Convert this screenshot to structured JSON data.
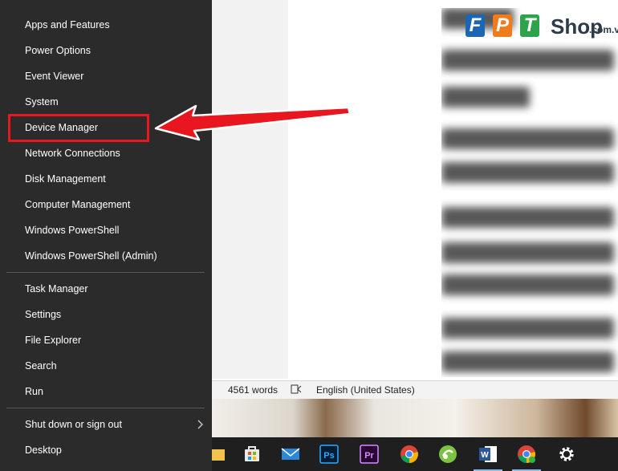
{
  "menu": {
    "groups": [
      [
        {
          "label": "Apps and Features"
        },
        {
          "label": "Power Options"
        },
        {
          "label": "Event Viewer"
        },
        {
          "label": "System"
        },
        {
          "label": "Device Manager"
        },
        {
          "label": "Network Connections"
        },
        {
          "label": "Disk Management"
        },
        {
          "label": "Computer Management"
        },
        {
          "label": "Windows PowerShell"
        },
        {
          "label": "Windows PowerShell (Admin)"
        }
      ],
      [
        {
          "label": "Task Manager"
        },
        {
          "label": "Settings"
        },
        {
          "label": "File Explorer"
        },
        {
          "label": "Search"
        },
        {
          "label": "Run"
        }
      ],
      [
        {
          "label": "Shut down or sign out"
        },
        {
          "label": "Desktop"
        }
      ]
    ],
    "highlighted_item": "Device Manager"
  },
  "status_bar": {
    "word_count": "4561 words",
    "language": "English (United States)"
  },
  "logo": {
    "letters": [
      "F",
      "P",
      "T"
    ],
    "shop": "Shop",
    "domain": ".com.vn",
    "colors": [
      "#1a66b3",
      "#f07b1a",
      "#2da44a"
    ]
  },
  "taskbar": {
    "icons": [
      "file-explorer-icon",
      "microsoft-store-icon",
      "mail-icon",
      "photoshop-icon",
      "premiere-icon",
      "chrome-icon",
      "green-app-icon",
      "word-icon",
      "chrome-profile-icon",
      "settings-icon"
    ]
  },
  "colors": {
    "menu_bg": "#2b2b2b",
    "highlight": "#e8161e"
  }
}
